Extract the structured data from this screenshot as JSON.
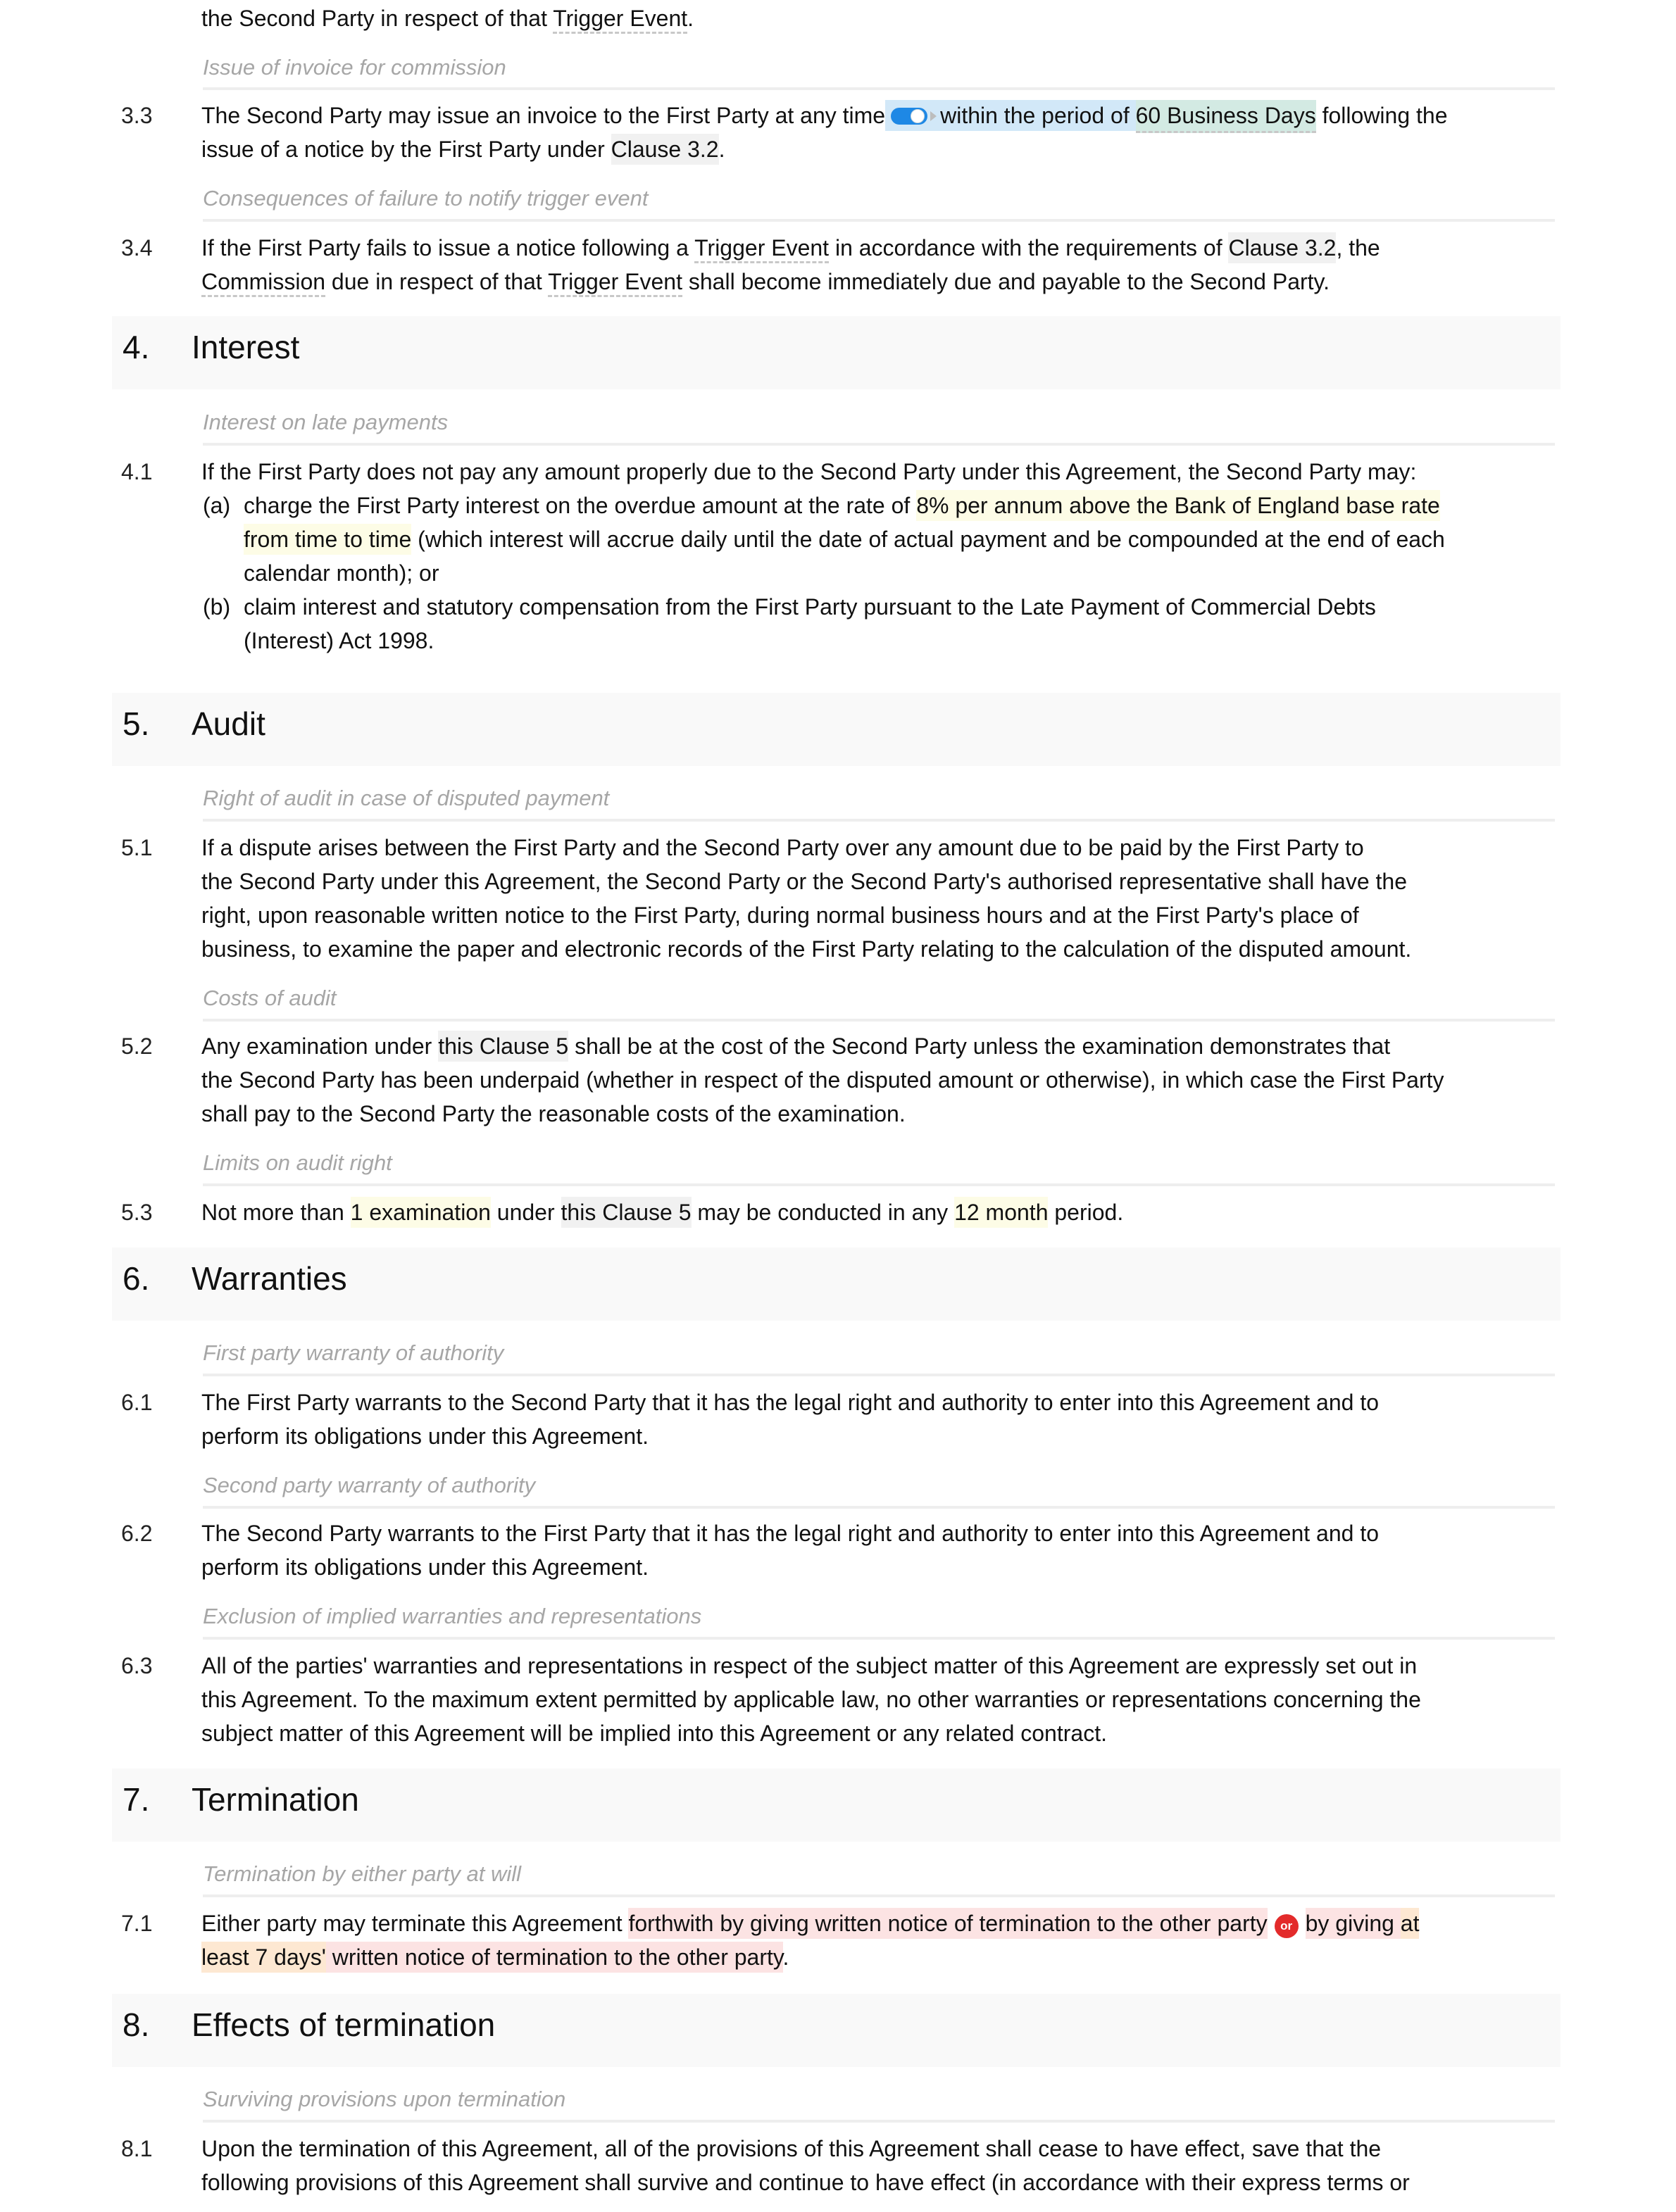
{
  "fragment_top": {
    "text_before": "the Second Party in respect of that ",
    "def_trigger": "Trigger Event",
    "text_after": "."
  },
  "clause_3_3": {
    "subheading": "Issue of invoice for commission",
    "number": "3.3",
    "line1_before": "The Second Party may issue an invoice to the First Party at any time",
    "toggle_state": "on",
    "optional_text": "within the period of ",
    "variable": "60 Business Days",
    "line1_after": " following the",
    "line2_before": "issue of a notice by the First Party under ",
    "ref": "Clause 3.2",
    "line2_after": "."
  },
  "clause_3_4": {
    "subheading": "Consequences of failure to notify trigger event",
    "number": "3.4",
    "l1a": "If the First Party fails to issue a notice following a ",
    "def1": "Trigger Event",
    "l1b": " in accordance with the requirements of ",
    "ref": "Clause 3.2",
    "l1c": ", the",
    "def2": "Commission",
    "l2a": " due in respect of that ",
    "def3": "Trigger Event",
    "l2b": " shall become immediately due and payable to the Second Party."
  },
  "section_4": {
    "number": "4.",
    "title": "Interest",
    "subheading": "Interest on late payments",
    "clause_number": "4.1",
    "intro": "If the First Party does not pay any amount properly due to the Second Party under this Agreement, the Second Party may:",
    "a_label": "(a)",
    "a_l1_before": "charge the First Party interest on the overdue amount at the rate of ",
    "a_var1": "8% per annum above the Bank of England base rate",
    "a_var2": "from time to time",
    "a_l2_after": " (which interest will accrue daily until the date of actual payment and be compounded at the end of each",
    "a_l3": "calendar month); or",
    "b_label": "(b)",
    "b_l1": "claim interest and statutory compensation from the First Party pursuant to the Late Payment of Commercial Debts",
    "b_l2": "(Interest) Act 1998."
  },
  "section_5": {
    "number": "5.",
    "title": "Audit",
    "c1": {
      "subheading": "Right of audit in case of disputed payment",
      "number": "5.1",
      "lines": [
        "If a dispute arises between the First Party and the Second Party over any amount due to be paid by the First Party to",
        "the Second Party under this Agreement, the Second Party or the Second Party's authorised representative shall have the",
        "right, upon reasonable written notice to the First Party, during normal business hours and at the First Party's place of",
        "business, to examine the paper and electronic records of the First Party relating to the calculation of the disputed amount."
      ]
    },
    "c2": {
      "subheading": "Costs of audit",
      "number": "5.2",
      "l1a": "Any examination under ",
      "ref": "this Clause 5",
      "l1b": " shall be at the cost of the Second Party unless the examination demonstrates that",
      "l2": "the Second Party has been underpaid (whether in respect of the disputed amount or otherwise), in which case the First Party",
      "l3": "shall pay to the Second Party the reasonable costs of the examination."
    },
    "c3": {
      "subheading": "Limits on audit right",
      "number": "5.3",
      "a": "Not more than ",
      "var1": "1 examination",
      "b": " under ",
      "ref": "this Clause 5",
      "c": " may be conducted in any ",
      "var2": "12 month",
      "d": " period."
    }
  },
  "section_6": {
    "number": "6.",
    "title": "Warranties",
    "c1": {
      "subheading": "First party warranty of authority",
      "number": "6.1",
      "lines": [
        "The First Party warrants to the Second Party that it has the legal right and authority to enter into this Agreement and to",
        "perform its obligations under this Agreement."
      ]
    },
    "c2": {
      "subheading": "Second party warranty of authority",
      "number": "6.2",
      "lines": [
        "The Second Party warrants to the First Party that it has the legal right and authority to enter into this Agreement and to",
        "perform its obligations under this Agreement."
      ]
    },
    "c3": {
      "subheading": "Exclusion of implied warranties and representations",
      "number": "6.3",
      "lines": [
        "All of the parties' warranties and representations in respect of the subject matter of this Agreement are expressly set out in",
        "this Agreement. To the maximum extent permitted by applicable law, no other warranties or representations concerning the",
        "subject matter of this Agreement will be implied into this Agreement or any related contract."
      ]
    }
  },
  "section_7": {
    "number": "7.",
    "title": "Termination",
    "subheading": "Termination by either party at will",
    "clause_number": "7.1",
    "l1a": "Either party may terminate this Agreement ",
    "option1": "forthwith by giving written notice of termination to the other party",
    "or_label": "or",
    "option2_a": "by giving ",
    "option2_var_l1": "at",
    "option2_var_l2": "least 7 days'",
    "option2_b": " written notice of termination to the other party",
    "l2_end": "."
  },
  "section_8": {
    "number": "8.",
    "title": "Effects of termination",
    "subheading": "Surviving provisions upon termination",
    "clause_number": "8.1",
    "lines": [
      "Upon the termination of this Agreement, all of the provisions of this Agreement shall cease to have effect, save that the",
      "following provisions of this Agreement shall survive and continue to have effect (in accordance with their express terms or"
    ]
  },
  "colors": {
    "section_band": "#f9f9f9",
    "subheading": "#a6a6a6",
    "rule": "#eeeeee",
    "reference_highlight": "#f1f1f1",
    "variable_highlight": "#fdfce6",
    "optional_highlight": "#d2e8f8",
    "option_highlight": "#fce3e3",
    "toggle": "#1e88e5",
    "or_badge": "#e32b2b"
  }
}
